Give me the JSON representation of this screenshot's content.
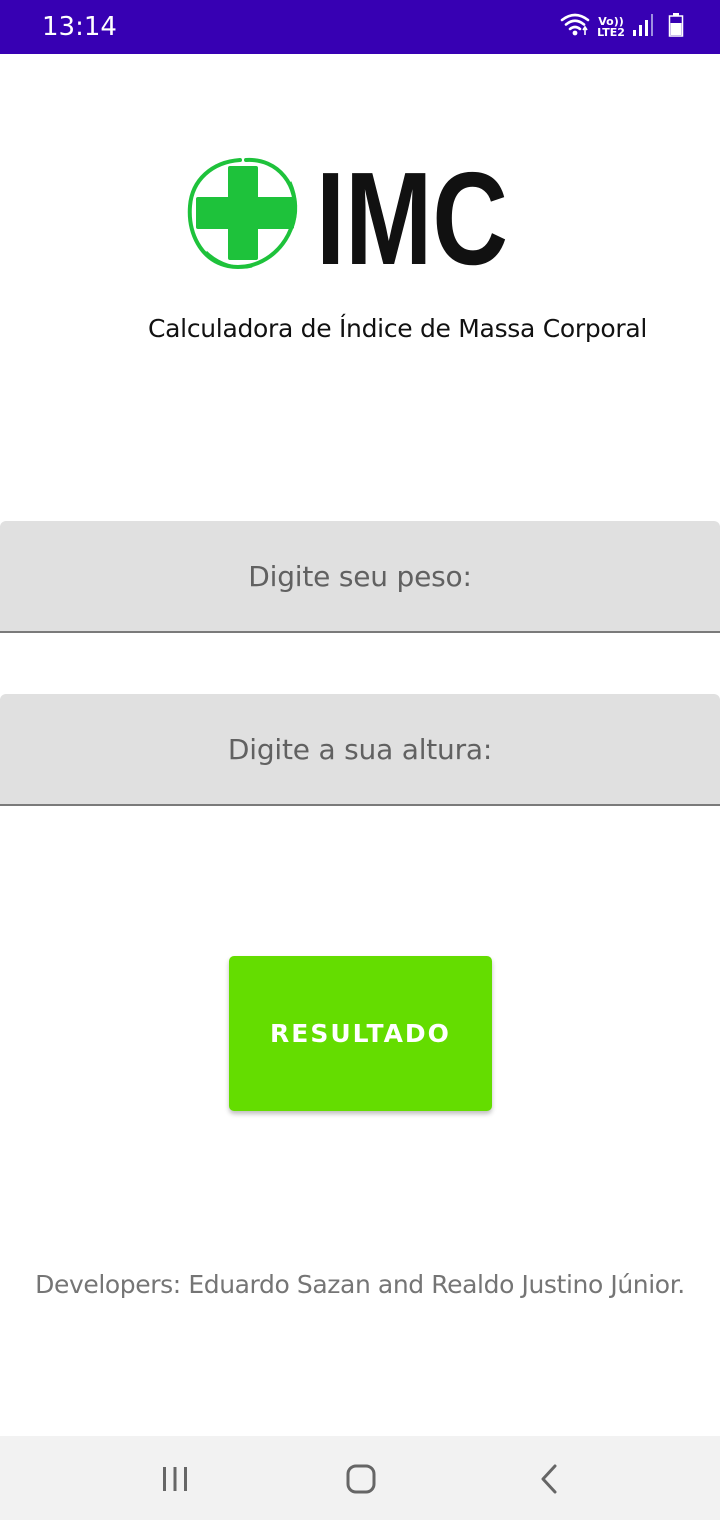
{
  "status_bar": {
    "time": "13:14",
    "network_label": "Vo)) LTE2",
    "icons": [
      "wifi-icon",
      "lte-icon",
      "signal-icon",
      "battery-icon"
    ],
    "background_color": "#3700b3"
  },
  "logo": {
    "text": "IMC",
    "cross_color": "#1ec23b"
  },
  "subtitle": "Calculadora de Índice de Massa Corporal",
  "form": {
    "weight_placeholder": "Digite seu peso:",
    "weight_value": "",
    "height_placeholder": "Digite a sua altura:",
    "height_value": ""
  },
  "result_button": {
    "label": "RESULTADO",
    "color": "#64dd00"
  },
  "credits": "Developers: Eduardo Sazan and Realdo Justino Júnior.",
  "nav_bar": {
    "icons": [
      "recent-apps-icon",
      "home-icon",
      "back-icon"
    ]
  }
}
